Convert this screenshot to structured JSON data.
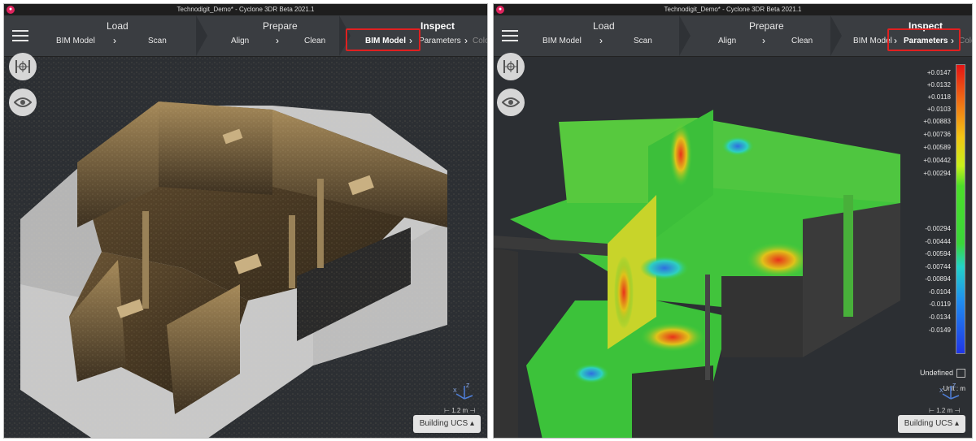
{
  "window": {
    "title": "Technodigit_Demo* - Cyclone 3DR Beta 2021.1"
  },
  "left": {
    "steps": [
      {
        "title": "Load",
        "items": [
          "BIM Model",
          "Scan"
        ]
      },
      {
        "title": "Prepare",
        "items": [
          "Align",
          "Clean"
        ]
      },
      {
        "title": "Inspect",
        "items": [
          "BIM Model",
          "Parameters",
          "Colo"
        ]
      }
    ],
    "highlighted": "BIM Model",
    "ucs_label": "Building UCS",
    "scale_label": "1.2 m"
  },
  "right": {
    "steps": [
      {
        "title": "Load",
        "items": [
          "BIM Model",
          "Scan"
        ]
      },
      {
        "title": "Prepare",
        "items": [
          "Align",
          "Clean"
        ]
      },
      {
        "title": "Inspect",
        "items": [
          "BIM Model",
          "Parameters",
          "Colo"
        ]
      }
    ],
    "highlighted": "Parameters",
    "ucs_label": "Building UCS",
    "scale_label": "1.2 m",
    "legend": {
      "values": [
        "+0.0147",
        "+0.0132",
        "+0.0118",
        "+0.0103",
        "+0.00883",
        "+0.00736",
        "+0.00589",
        "+0.00442",
        "+0.00294",
        "-0.00294",
        "-0.00444",
        "-0.00594",
        "-0.00744",
        "-0.00894",
        "-0.0104",
        "-0.0119",
        "-0.0134",
        "-0.0149"
      ],
      "undefined_label": "Undefined",
      "unit_label": "Unit : m"
    }
  },
  "icons": {
    "menu": "hamburger-icon",
    "camera": "view-fit-icon",
    "eye": "eye-icon"
  },
  "colors": {
    "highlight": "#e02020",
    "viewport": "#2c2f33"
  }
}
